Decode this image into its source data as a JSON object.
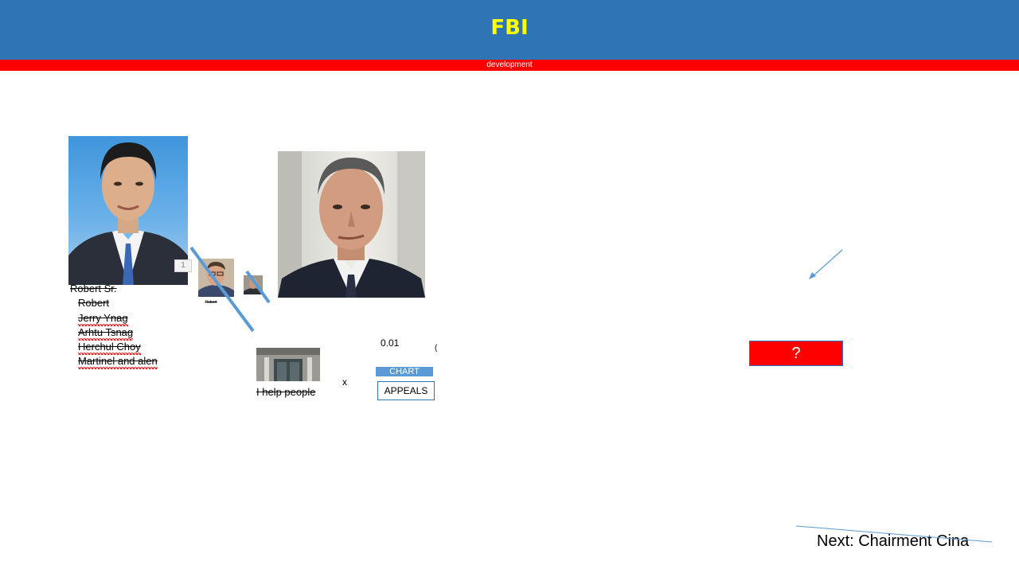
{
  "header": {
    "title": "FBI",
    "subtitle": "development"
  },
  "badge": "1",
  "names": {
    "top": "Robert Sr.",
    "items": [
      "Robert",
      "Jerry Ynag",
      "Arhtu Tsnag",
      "Herchul Choy",
      "Martinel and alen"
    ]
  },
  "small_caption": "Robert",
  "building_caption": "I help people",
  "x_label": "x",
  "value_label": "0.01",
  "paren_label": "(",
  "buttons": {
    "chart": "CHART",
    "appeals": "APPEALS",
    "question": "?"
  },
  "next": "Next: Chairment Cina",
  "colors": {
    "header_bg": "#2e75b6",
    "title": "#ffff00",
    "dev_bar": "#ff0000",
    "accent_line": "#5b9bd5"
  }
}
